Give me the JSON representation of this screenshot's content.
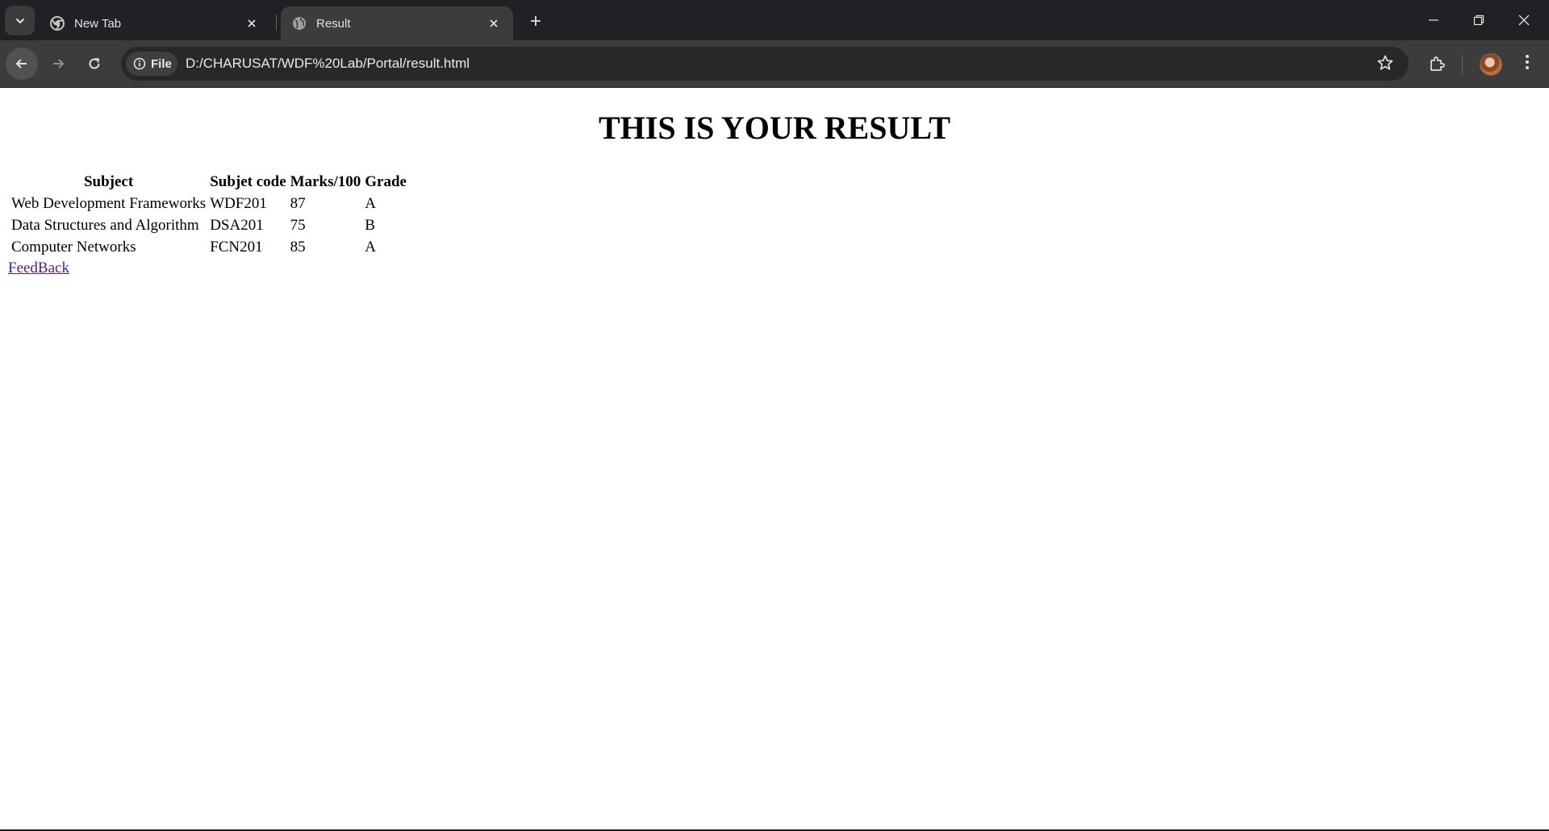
{
  "tabs": [
    {
      "title": "New Tab",
      "icon": "chrome-icon",
      "active": false
    },
    {
      "title": "Result",
      "icon": "globe-icon",
      "active": true
    }
  ],
  "address_bar": {
    "chip_label": "File",
    "url": "D:/CHARUSAT/WDF%20Lab/Portal/result.html"
  },
  "page": {
    "heading": "THIS IS YOUR RESULT",
    "table": {
      "headers": [
        "Subject",
        "Subjet code",
        "Marks/100",
        "Grade"
      ],
      "rows": [
        [
          "Web Development Frameworks",
          "WDF201",
          "87",
          "A"
        ],
        [
          "Data Structures and Algorithm",
          "DSA201",
          "75",
          "B"
        ],
        [
          "Computer Networks",
          "FCN201",
          "85",
          "A"
        ]
      ]
    },
    "link": "FeedBack"
  },
  "colors": {
    "tabstrip_bg": "#202124",
    "toolbar_bg": "#3c3c3c",
    "omnibox_bg": "#282828",
    "visited_link": "#551a8b"
  }
}
